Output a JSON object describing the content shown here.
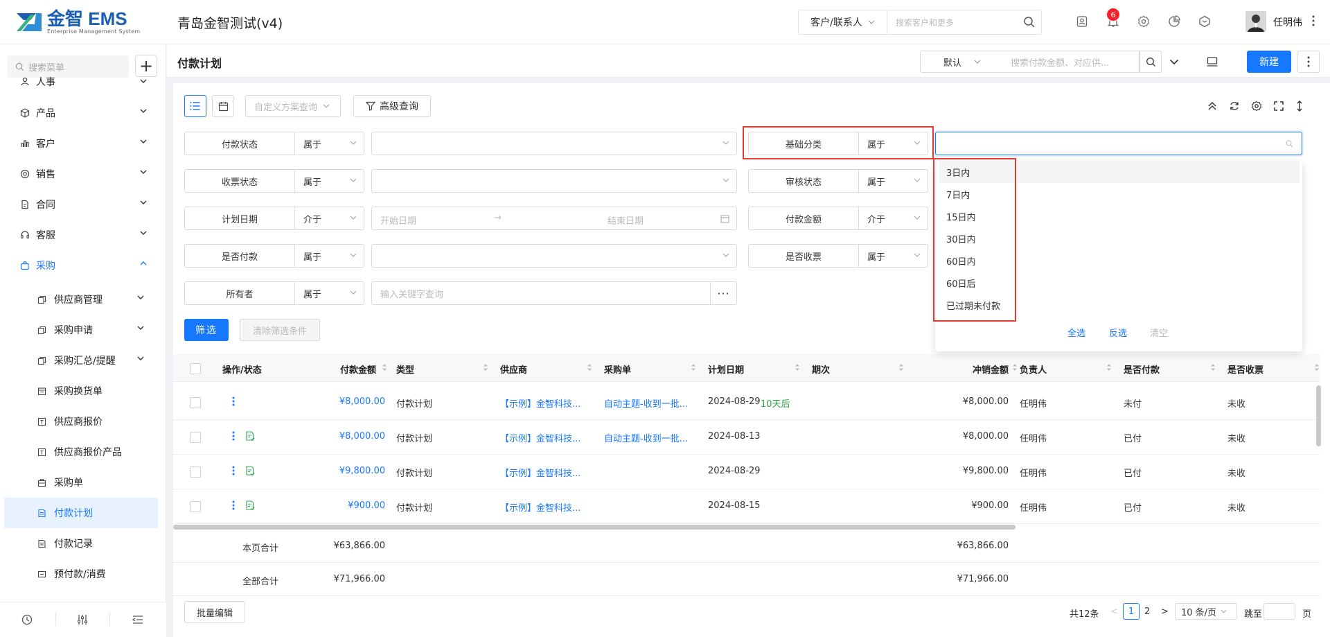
{
  "header": {
    "logo_text": "金智 EMS",
    "logo_sub": "Enterprise Management System",
    "company": "青岛金智测试(v4)",
    "search_scope": "客户/联系人",
    "search_placeholder": "搜索客户和更多",
    "notification_count": "6",
    "user_name": "任明伟"
  },
  "sidebar": {
    "search_placeholder": "搜索菜单",
    "add_label": "+",
    "items": [
      {
        "label": "人事"
      },
      {
        "label": "产品"
      },
      {
        "label": "客户"
      },
      {
        "label": "销售"
      },
      {
        "label": "合同"
      },
      {
        "label": "客服"
      },
      {
        "label": "采购"
      }
    ],
    "subitems": [
      {
        "label": "供应商管理"
      },
      {
        "label": "采购申请"
      },
      {
        "label": "采购汇总/提醒"
      },
      {
        "label": "采购换货单"
      },
      {
        "label": "供应商报价"
      },
      {
        "label": "供应商报价产品"
      },
      {
        "label": "采购单"
      },
      {
        "label": "付款计划"
      },
      {
        "label": "付款记录"
      },
      {
        "label": "预付款/消费"
      }
    ]
  },
  "page": {
    "title": "付款计划",
    "view_select": "默认",
    "search_placeholder": "搜索付款金额、对应供...",
    "new_button": "新建"
  },
  "toolbar": {
    "scheme_placeholder": "自定义方案查询",
    "advanced_label": "高级查询"
  },
  "filters": {
    "rows": [
      {
        "left_label": "付款状态",
        "left_op": "属于",
        "right_label": "基础分类",
        "right_op": "属于"
      },
      {
        "left_label": "收票状态",
        "left_op": "属于",
        "right_label": "审核状态",
        "right_op": "属于"
      },
      {
        "left_label": "计划日期",
        "left_op": "介于",
        "right_label": "付款金额",
        "right_op": "介于"
      },
      {
        "left_label": "是否付款",
        "left_op": "属于",
        "right_label": "是否收票",
        "right_op": "属于"
      },
      {
        "left_label": "所有者",
        "left_op": "属于"
      }
    ],
    "date_start": "开始日期",
    "date_end": "结束日期",
    "keyword_placeholder": "输入关键字查询",
    "filter_button": "筛选",
    "clear_button": "清除筛选条件"
  },
  "dropdown": {
    "options": [
      "3日内",
      "7日内",
      "15日内",
      "30日内",
      "60日内",
      "60日后",
      "已过期未付款"
    ],
    "select_all": "全选",
    "invert": "反选",
    "clear": "清空"
  },
  "table": {
    "columns": [
      "操作/状态",
      "付款金额",
      "类型",
      "供应商",
      "采购单",
      "计划日期",
      "期次",
      "冲销金额",
      "负责人",
      "是否付款",
      "是否收票"
    ],
    "rows": [
      {
        "amount": "¥8,000.00",
        "type": "付款计划",
        "supplier": "【示例】金智科技...",
        "order": "自动主题-收到一批...",
        "date": "2024-08-29",
        "date_tag": "10天后",
        "period": "",
        "offset": "¥8,000.00",
        "owner": "任明伟",
        "paid": "未付",
        "invoiced": "未收"
      },
      {
        "amount": "¥8,000.00",
        "type": "付款计划",
        "supplier": "【示例】金智科技...",
        "order": "自动主题-收到一批...",
        "date": "2024-08-13",
        "date_tag": "",
        "period": "",
        "offset": "¥8,000.00",
        "owner": "任明伟",
        "paid": "已付",
        "invoiced": "未收"
      },
      {
        "amount": "¥9,800.00",
        "type": "付款计划",
        "supplier": "【示例】金智科技...",
        "order": "",
        "date": "2024-08-29",
        "date_tag": "",
        "period": "",
        "offset": "¥9,800.00",
        "owner": "任明伟",
        "paid": "已付",
        "invoiced": "未收"
      },
      {
        "amount": "¥900.00",
        "type": "付款计划",
        "supplier": "【示例】金智科技...",
        "order": "",
        "date": "2024-08-15",
        "date_tag": "",
        "period": "",
        "offset": "¥900.00",
        "owner": "任明伟",
        "paid": "已付",
        "invoiced": "未收"
      }
    ],
    "page_total_label": "本页合计",
    "page_total_amount": "¥63,866.00",
    "page_total_offset": "¥63,866.00",
    "all_total_label": "全部合计",
    "all_total_amount": "¥71,966.00",
    "all_total_offset": "¥71,966.00"
  },
  "footer": {
    "batch_edit": "批量编辑",
    "total": "共12条",
    "page1": "1",
    "page2": "2",
    "page_size": "10 条/页",
    "goto_label": "跳至",
    "page_suffix": "页"
  },
  "colors": {
    "primary": "#1677ff",
    "danger": "#f5222d",
    "highlight_box": "#e53935",
    "positive": "#2ba44a"
  }
}
